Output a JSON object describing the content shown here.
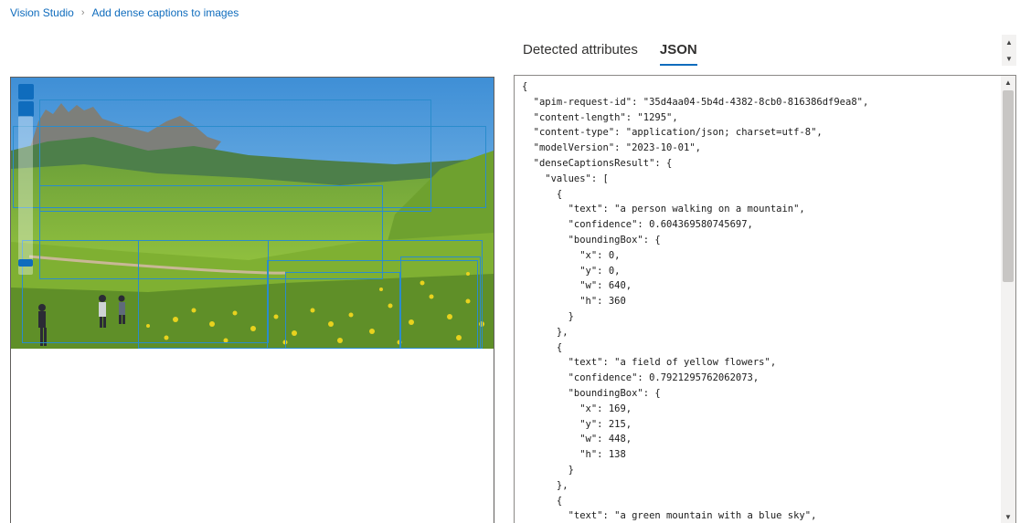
{
  "breadcrumb": {
    "root": "Vision Studio",
    "separator": "›",
    "current": "Add dense captions to images"
  },
  "tabs": [
    {
      "label": "Detected attributes",
      "active": false
    },
    {
      "label": "JSON",
      "active": true
    }
  ],
  "scroll_icons": {
    "up": "▲",
    "down": "▼"
  },
  "colors": {
    "accent": "#0f6cbd",
    "bbox": "#2a8ccc"
  },
  "json_text": "{\n  \"apim-request-id\": \"35d4aa04-5b4d-4382-8cb0-816386df9ea8\",\n  \"content-length\": \"1295\",\n  \"content-type\": \"application/json; charset=utf-8\",\n  \"modelVersion\": \"2023-10-01\",\n  \"denseCaptionsResult\": {\n    \"values\": [\n      {\n        \"text\": \"a person walking on a mountain\",\n        \"confidence\": 0.604369580745697,\n        \"boundingBox\": {\n          \"x\": 0,\n          \"y\": 0,\n          \"w\": 640,\n          \"h\": 360\n        }\n      },\n      {\n        \"text\": \"a field of yellow flowers\",\n        \"confidence\": 0.7921295762062073,\n        \"boundingBox\": {\n          \"x\": 169,\n          \"y\": 215,\n          \"w\": 448,\n          \"h\": 138\n        }\n      },\n      {\n        \"text\": \"a green mountain with a blue sky\","
}
